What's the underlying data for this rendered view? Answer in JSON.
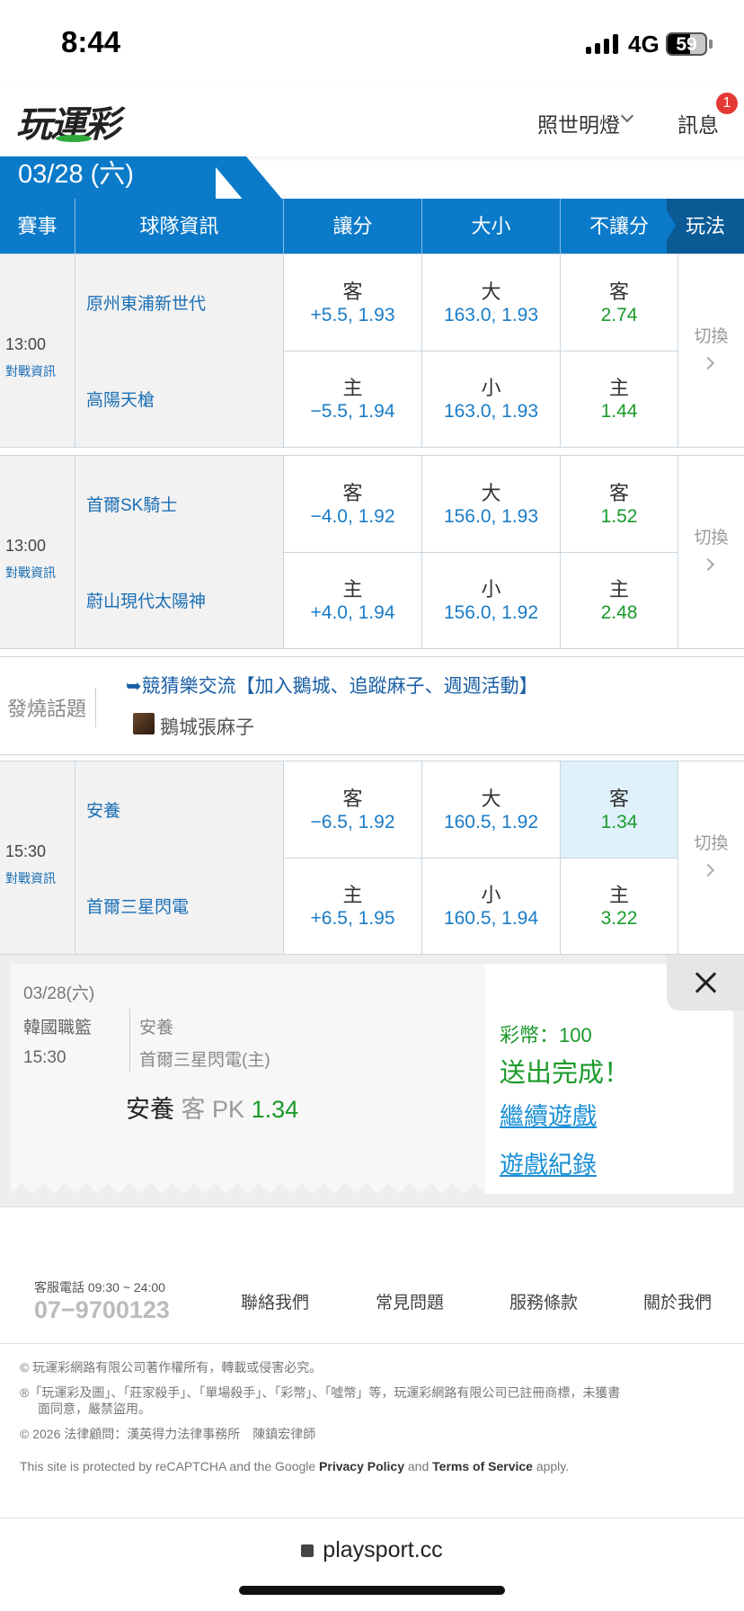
{
  "status": {
    "time": "8:44",
    "network": "4G",
    "battery": "59"
  },
  "header": {
    "logo": "玩運彩",
    "user_menu": "照世明燈",
    "messages": "訊息",
    "msg_count": "1"
  },
  "date_tab": "03/28 (六)",
  "table_header": {
    "game": "賽事",
    "team": "球隊資訊",
    "spread": "讓分",
    "total": "大小",
    "moneyline": "不讓分",
    "play": "玩法"
  },
  "games": [
    {
      "time": "13:00",
      "info": "對戰資訊",
      "switch": "切換",
      "away": {
        "team": "原州東浦新世代",
        "spread_label": "客",
        "spread": "+5.5, 1.93",
        "total_label": "大",
        "total": "163.0, 1.93",
        "ml_label": "客",
        "ml": "2.74"
      },
      "home": {
        "team": "高陽天槍",
        "spread_label": "主",
        "spread": "−5.5, 1.94",
        "total_label": "小",
        "total": "163.0, 1.93",
        "ml_label": "主",
        "ml": "1.44"
      }
    },
    {
      "time": "13:00",
      "info": "對戰資訊",
      "switch": "切換",
      "away": {
        "team": "首爾SK騎士",
        "spread_label": "客",
        "spread": "−4.0, 1.92",
        "total_label": "大",
        "total": "156.0, 1.93",
        "ml_label": "客",
        "ml": "1.52"
      },
      "home": {
        "team": "蔚山現代太陽神",
        "spread_label": "主",
        "spread": "+4.0, 1.94",
        "total_label": "小",
        "total": "156.0, 1.92",
        "ml_label": "主",
        "ml": "2.48"
      }
    },
    {
      "time": "15:30",
      "info": "對戰資訊",
      "switch": "切換",
      "away": {
        "team": "安養",
        "spread_label": "客",
        "spread": "−6.5, 1.92",
        "total_label": "大",
        "total": "160.5, 1.92",
        "ml_label": "客",
        "ml": "1.34"
      },
      "home": {
        "team": "首爾三星閃電",
        "spread_label": "主",
        "spread": "+6.5, 1.95",
        "total_label": "小",
        "total": "160.5, 1.94",
        "ml_label": "主",
        "ml": "3.22"
      }
    }
  ],
  "hot_topic": {
    "label": "發燒話題",
    "link": "➥競猜樂交流【加入鵝城、追蹤麻子、週週活動】",
    "author": "鵝城張麻子"
  },
  "receipt": {
    "date": "03/28(六)",
    "league": "韓國職籃",
    "time": "15:30",
    "team1": "安養",
    "team2": "首爾三星閃電(主)",
    "pick_team": "安養",
    "pick_side": "客 PK",
    "pick_odds": "1.34",
    "coins": "彩幣：100",
    "done": "送出完成！",
    "continue": "繼續遊戲",
    "history": "遊戲紀錄"
  },
  "footer": {
    "cs_label": "客服電話 09:30 ~ 24:00",
    "cs_phone": "07−9700123",
    "links": [
      "聯絡我們",
      "常見問題",
      "服務條款",
      "關於我們"
    ],
    "copyright": "© 玩運彩網路有限公司著作權所有，轉載或侵害必究。",
    "trademark1": "®「玩運彩及圖」、「莊家殺手」、「單場殺手」、「彩幣」、「噓幣」等，玩運彩網路有限公司已註冊商標，未獲書",
    "trademark2": "面同意，嚴禁盜用。",
    "counsel": "© 2026 法律顧問：漢英得力法律事務所　陳鎮宏律師",
    "recaptcha_pre": "This site is protected by reCAPTCHA and the Google ",
    "privacy": "Privacy Policy",
    "and": " and ",
    "terms": "Terms of Service",
    "apply": " apply."
  },
  "url": "playsport.cc"
}
